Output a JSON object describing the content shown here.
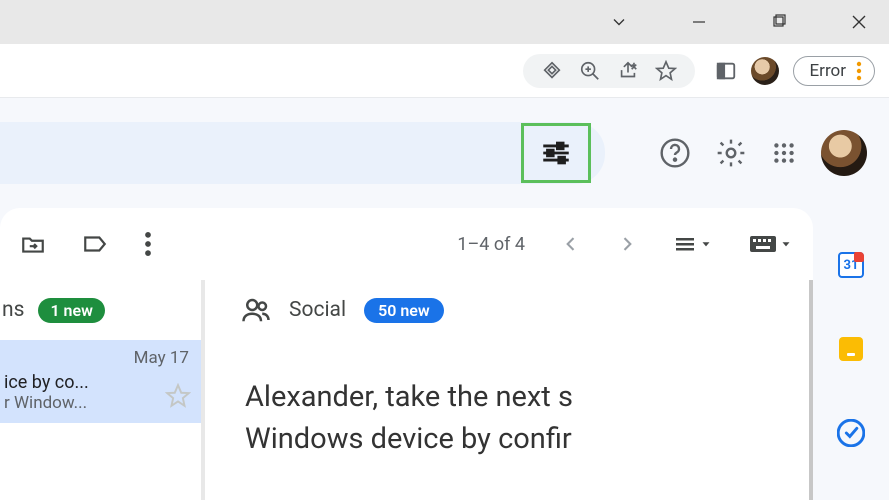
{
  "window": {
    "chevron": "⌄"
  },
  "chrome": {
    "error_label": "Error"
  },
  "gmail": {
    "pagination": "1–4 of 4",
    "tabs": {
      "partial_label": "ns",
      "partial_badge": "1 new",
      "social_label": "Social",
      "social_badge": "50 new"
    },
    "list_item": {
      "date": "May 17",
      "line1": "ice by co...",
      "line2": "r Window..."
    },
    "message": {
      "line1": "Alexander, take the next s",
      "line2": "Windows device by confir"
    },
    "sidepanel": {
      "calendar_day": "31"
    }
  }
}
